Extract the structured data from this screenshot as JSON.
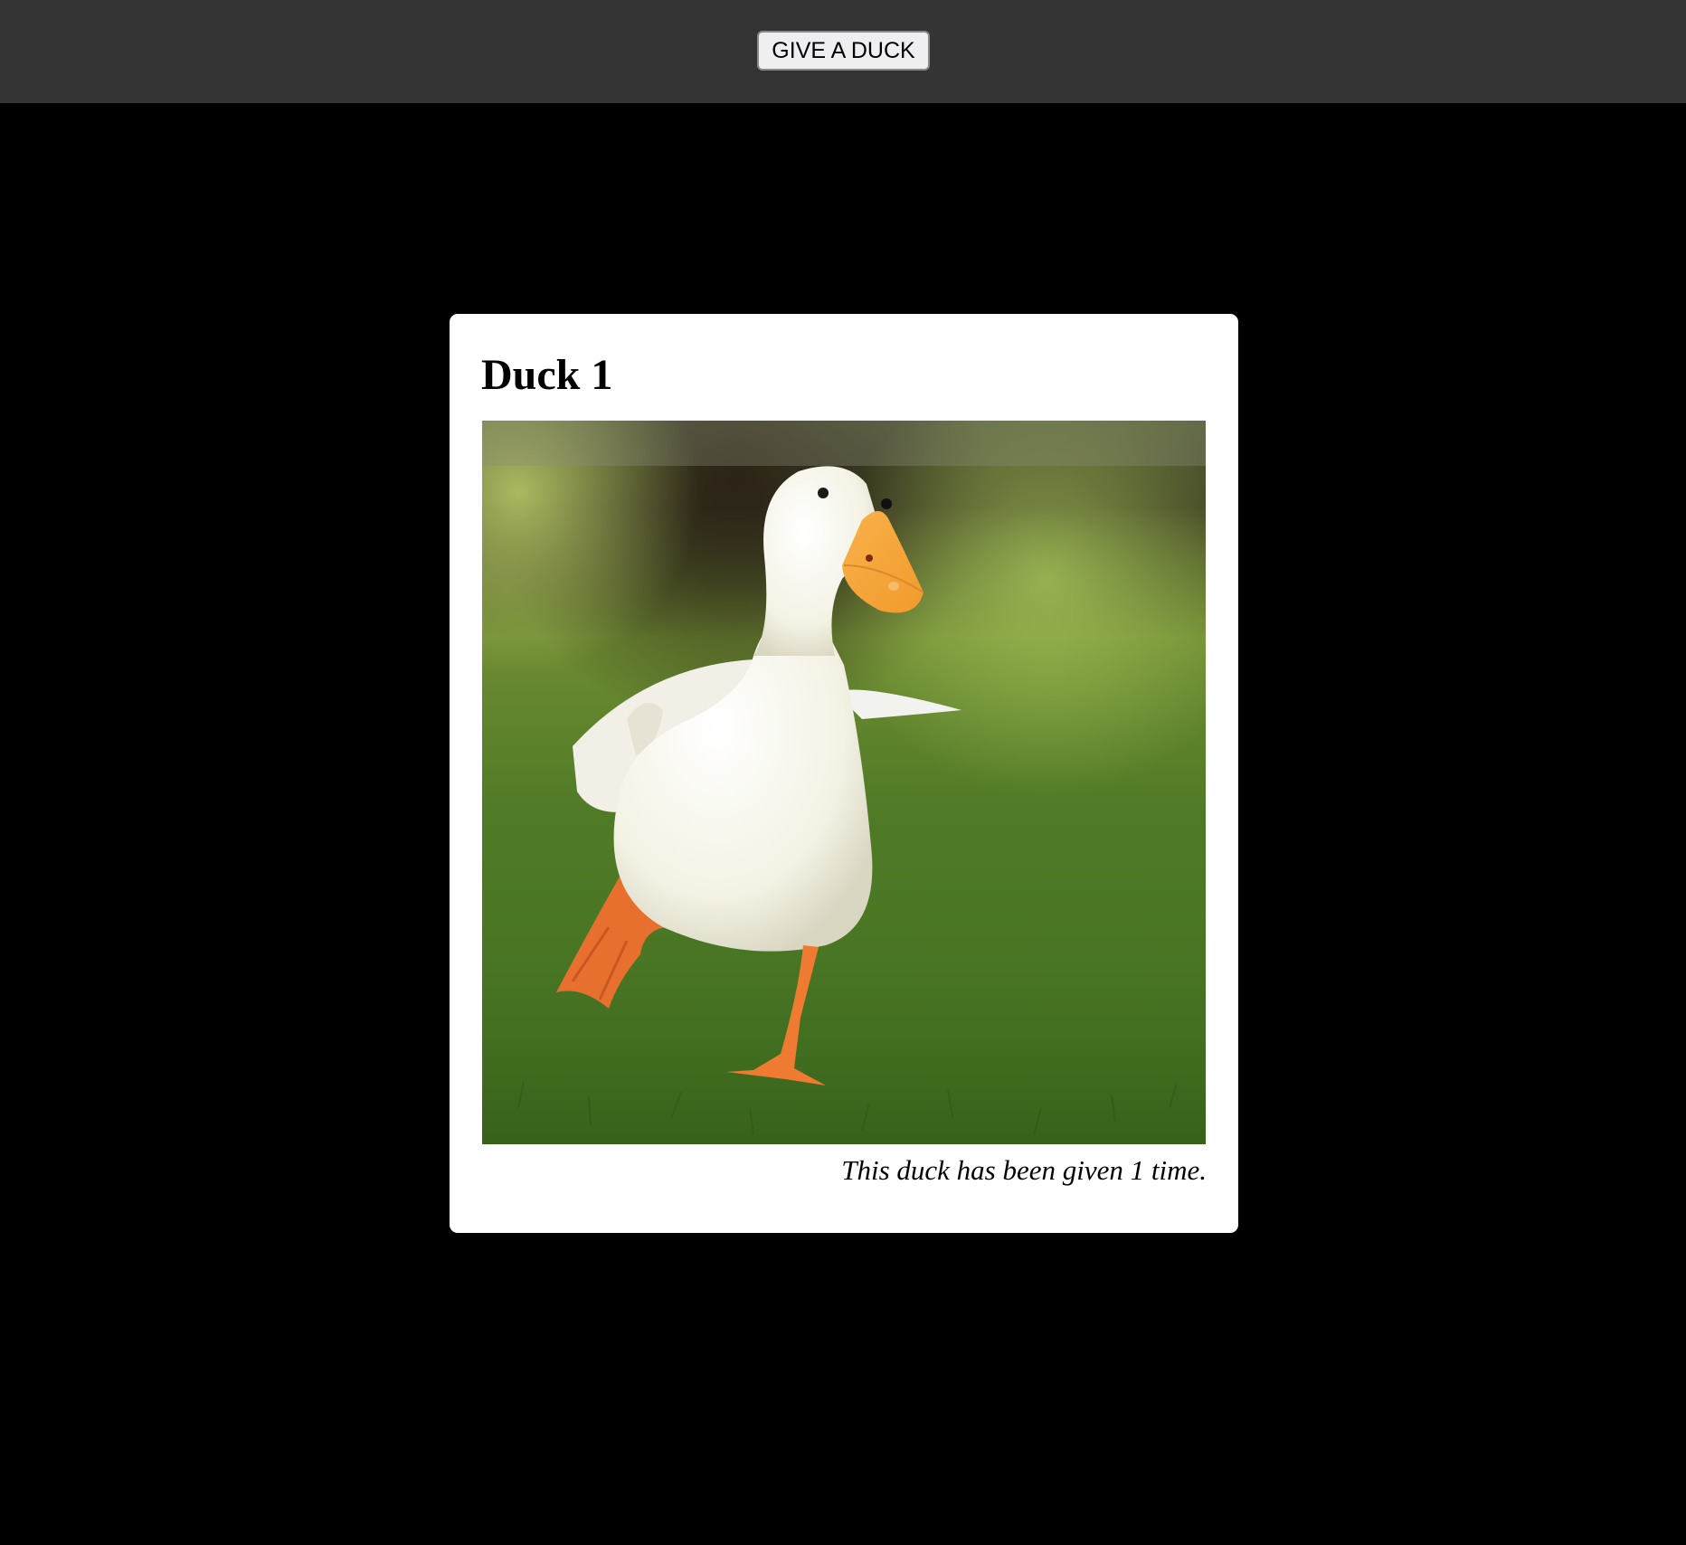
{
  "toolbar": {
    "give_button_label": "GIVE A DUCK"
  },
  "card": {
    "title": "Duck 1",
    "photo_subject": "white duck walking on grass",
    "caption": "This duck has been given 1 time."
  }
}
